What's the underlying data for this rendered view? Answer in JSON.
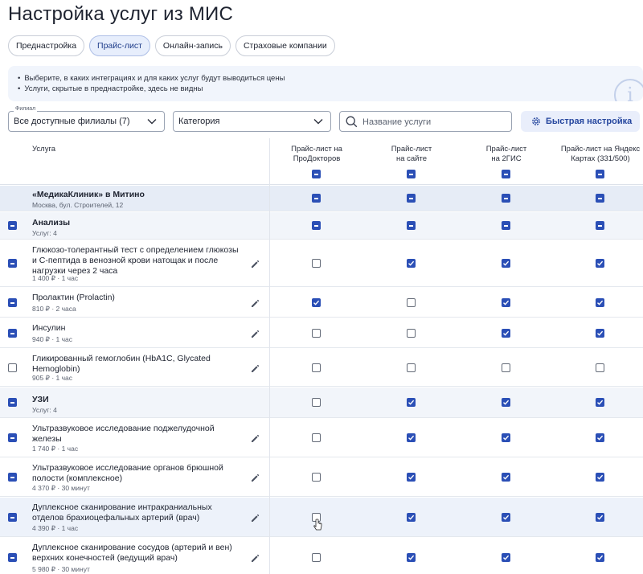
{
  "page": {
    "title": "Настройка услуг из МИС"
  },
  "tabs": [
    {
      "label": "Преднастройка",
      "active": false
    },
    {
      "label": "Прайс-лист",
      "active": true
    },
    {
      "label": "Онлайн-запись",
      "active": false
    },
    {
      "label": "Страховые компании",
      "active": false
    }
  ],
  "info": {
    "lines": [
      "Выберите, в каких интеграциях и для каких услуг будут выводиться цены",
      "Услуги, скрытые в преднастройке, здесь не видны"
    ],
    "icon": "info-icon"
  },
  "filters": {
    "branch_label": "Филиал",
    "branch_value": "Все доступные филиалы (7)",
    "category_placeholder": "Категория",
    "search_placeholder": "Название услуги",
    "search_value": "",
    "quick_setup_label": "Быстрая настройка"
  },
  "table": {
    "service_header": "Услуга",
    "columns": [
      "Прайс-лист на\nПроДокторов",
      "Прайс-лист\nна сайте",
      "Прайс-лист\nна 2ГИС",
      "Прайс-лист на Яндекс\nКартах (331/500)"
    ],
    "header_states": [
      "mixed",
      "mixed",
      "mixed",
      "mixed"
    ],
    "branch": {
      "name": "«МедикаКлиник» в Митино",
      "address": "Москва, бул. Строителей, 12",
      "states": [
        "mixed",
        "mixed",
        "mixed",
        "mixed"
      ]
    },
    "groups": [
      {
        "name": "Анализы",
        "count": "Услуг: 4",
        "row_state": "mixed",
        "states": [
          "mixed",
          "mixed",
          "mixed",
          "mixed"
        ],
        "items": [
          {
            "name": "Глюкозо-толерантный тест с определением глюкозы и С-пептида в венозной крови натощак и после нагрузки через 2 часа",
            "meta": "1 400 ₽ · 1 час",
            "row_state": "mixed",
            "states": [
              "off",
              "on",
              "on",
              "on"
            ]
          },
          {
            "name": "Пролактин (Prolactin)",
            "meta": "810 ₽ · 2 часа",
            "row_state": "mixed",
            "states": [
              "on",
              "off",
              "on",
              "on"
            ]
          },
          {
            "name": "Инсулин",
            "meta": "940 ₽ · 1 час",
            "row_state": "mixed",
            "states": [
              "off",
              "off",
              "on",
              "on"
            ]
          },
          {
            "name": "Гликированный гемоглобин (HbA1C, Glycated Hemoglobin)",
            "meta": "905 ₽ · 1 час",
            "row_state": "off",
            "states": [
              "off",
              "off",
              "off",
              "off"
            ]
          }
        ]
      },
      {
        "name": "УЗИ",
        "count": "Услуг: 4",
        "row_state": "mixed",
        "states": [
          "off",
          "on",
          "on",
          "on"
        ],
        "items": [
          {
            "name": "Ультразвуковое исследование поджелудочной железы",
            "meta": "1 740 ₽ · 1 час",
            "row_state": "mixed",
            "states": [
              "off",
              "on",
              "on",
              "on"
            ]
          },
          {
            "name": "Ультразвуковое исследование органов брюшной полости (комплексное)",
            "meta": "4 370 ₽ · 30 минут",
            "row_state": "mixed",
            "states": [
              "off",
              "on",
              "on",
              "on"
            ]
          },
          {
            "name": "Дуплексное сканирование интракраниальных отделов брахиоцефальных артерий (врач)",
            "meta": "4 390 ₽ · 1 час",
            "row_state": "mixed",
            "states": [
              "off",
              "on",
              "on",
              "on"
            ],
            "hovered": true
          },
          {
            "name": "Дуплексное сканирование сосудов (артерий и вен) верхних конечностей (ведущий врач)",
            "meta": "5 980 ₽ · 30 минут",
            "row_state": "mixed",
            "states": [
              "off",
              "on",
              "on",
              "on"
            ]
          }
        ]
      }
    ]
  },
  "colors": {
    "accent": "#2b4fb6",
    "branch_row_bg": "#e6ecf6",
    "group_row_bg": "#f2f5fa",
    "info_bg": "#f1f5fc",
    "quick_button_bg": "#e9eefb"
  }
}
